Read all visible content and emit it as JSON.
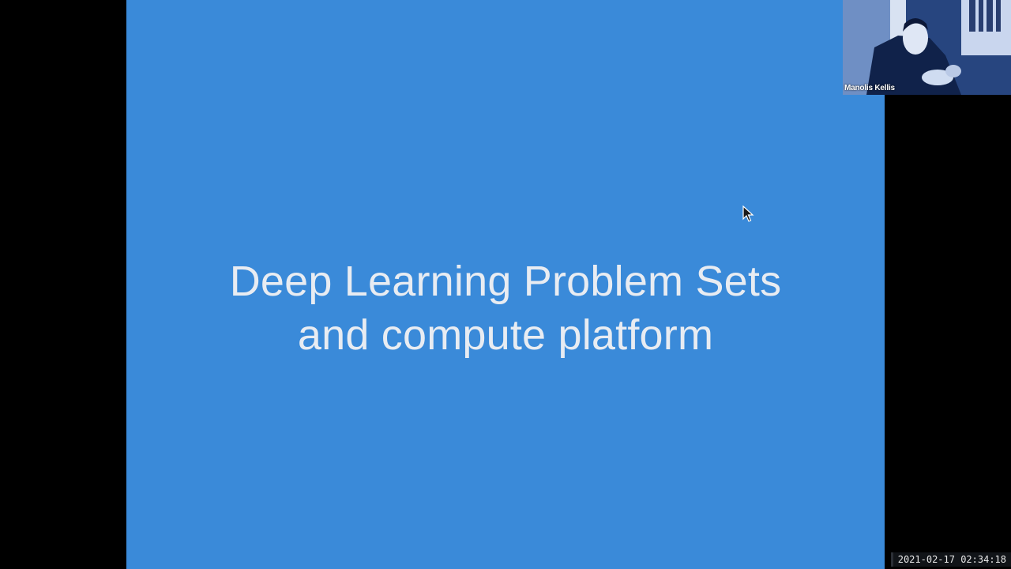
{
  "slide": {
    "title_line1": "Deep Learning Problem Sets",
    "title_line2": "and compute platform",
    "background_color": "#3a8ad9",
    "text_color": "#e8ecf2"
  },
  "video": {
    "participant_name": "Manolis Kellis"
  },
  "recording": {
    "timestamp": "2021-02-17  02:34:18"
  },
  "icons": {
    "cursor": "mouse-pointer-icon"
  }
}
